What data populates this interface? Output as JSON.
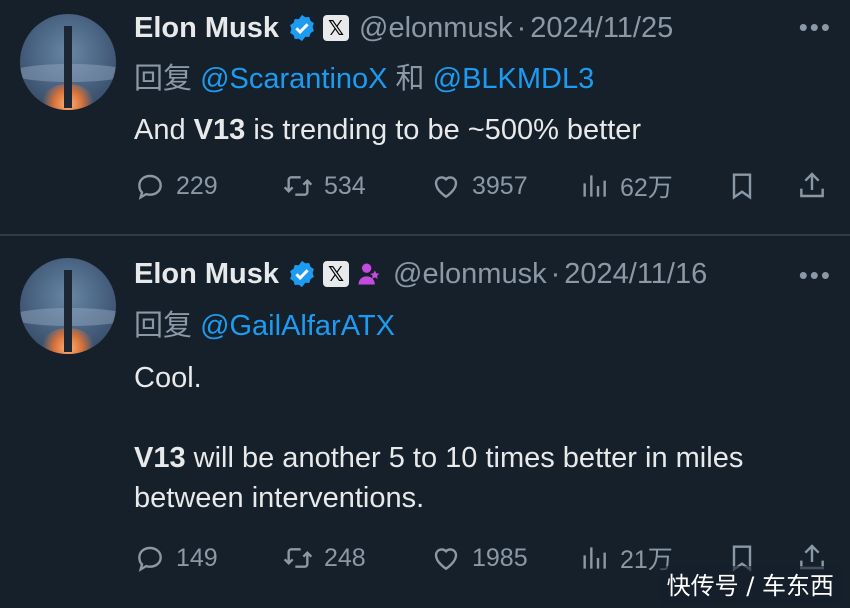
{
  "tweets": [
    {
      "name": "Elon Musk",
      "x_badge": "𝕏",
      "handle": "@elonmusk",
      "separator": "·",
      "date": "2024/11/25",
      "more": "•••",
      "reply_prefix": "回复 ",
      "reply_user1": "@ScarantinoX",
      "reply_join": " 和 ",
      "reply_user2": "@BLKMDL3",
      "text_pre": "And ",
      "text_bold": "V13",
      "text_post": " is trending to be ~500% better",
      "replies": "229",
      "retweets": "534",
      "likes": "3957",
      "views": "62万"
    },
    {
      "name": "Elon Musk",
      "x_badge": "𝕏",
      "handle": "@elonmusk",
      "separator": "·",
      "date": "2024/11/16",
      "more": "•••",
      "reply_prefix": "回复 ",
      "reply_user1": "@GailAlfarATX",
      "line1": "Cool.",
      "text_bold": "V13",
      "text_post": " will be another 5 to 10 times better in miles between interventions.",
      "replies": "149",
      "retweets": "248",
      "likes": "1985",
      "views": "21万"
    }
  ],
  "watermark": "快传号 / 车东西",
  "colors": {
    "background": "#15202b",
    "text": "#e7e9ea",
    "muted": "#8b98a5",
    "link": "#1d9bf0",
    "verified": "#1d9bf0",
    "affiliate": "#c54be0"
  },
  "icons": [
    "reply-icon",
    "retweet-icon",
    "like-icon",
    "views-icon",
    "bookmark-icon",
    "share-icon",
    "verified-icon",
    "x-badge-icon",
    "person-badge-icon",
    "more-icon"
  ]
}
